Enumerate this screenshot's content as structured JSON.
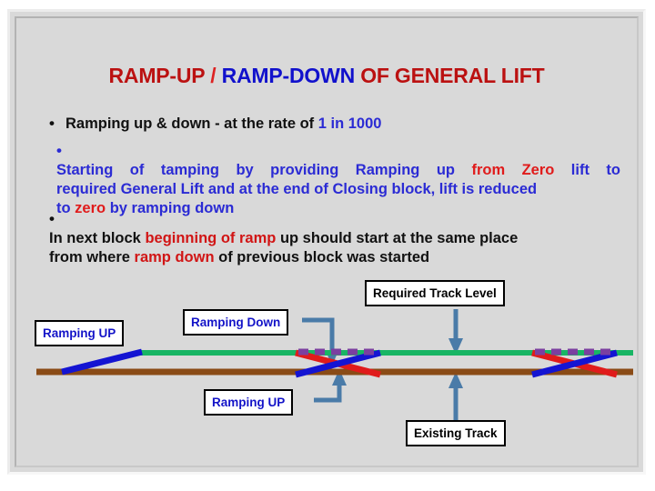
{
  "slide": {
    "title": {
      "part1": "RAMP-UP",
      "slash": " / ",
      "part2": "RAMP-DOWN",
      "part3": " OF GENERAL LIFT"
    },
    "bullets": [
      {
        "marker": "•",
        "segments": [
          {
            "text": "Ramping up & down - at the rate of ",
            "color": "black"
          },
          {
            "text": "1 in 1000",
            "color": "blue"
          }
        ]
      },
      {
        "marker": "•",
        "line1_a": "Starting  of  tamping  by  providing  Ramping  up ",
        "line1_b": "from  Zero",
        "line1_c": " lift  to",
        "line2": "required General Lift and  at the end of Closing block, lift is reduced",
        "line3_a": "to ",
        "line3_b": "zero",
        "line3_c": " by ramping down"
      },
      {
        "marker": "•",
        "line1_a": "In next block ",
        "line1_b": "beginning of ramp",
        "line1_c": " up should  start at the same place",
        "line2_a": "from where ",
        "line2_b": "ramp down",
        "line2_c": " of previous block was started"
      }
    ],
    "diagram": {
      "labels": {
        "ramping_up_left": "Ramping UP",
        "ramping_down": "Ramping Down",
        "required_track_level": "Required Track Level",
        "ramping_up_bottom": "Ramping UP",
        "existing_track": "Existing Track"
      },
      "colors": {
        "required_level_line": "#18b564",
        "existing_track_line": "#8a4b16",
        "ramp_up_line": "#1414d2",
        "ramp_down_line": "#e01b1b",
        "overlap_dash": "#7b3fa0",
        "connector": "#4a7ba8",
        "label_text_blue": "#1414c8",
        "label_text_black": "#000000",
        "slide_background": "#d9d9d9"
      }
    }
  }
}
